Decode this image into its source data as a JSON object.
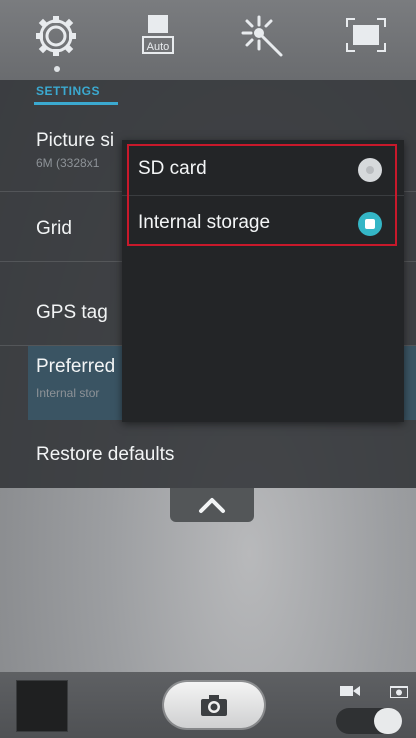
{
  "toolbar": {
    "settings_icon": "gear-icon",
    "scene_mode_label": "Auto",
    "effects_icon": "magic-wand-icon",
    "aspect_icon": "aspect-ratio-icon"
  },
  "settings": {
    "header": "SETTINGS",
    "rows": [
      {
        "title": "Picture si",
        "subtitle": "6M (3328x1"
      },
      {
        "title": "Grid"
      },
      {
        "title": "GPS tag"
      },
      {
        "title": "Preferred",
        "subtitle": "Internal stor"
      },
      {
        "title": "Restore defaults"
      }
    ]
  },
  "storage_popup": {
    "options": [
      {
        "label": "SD card",
        "selected": false
      },
      {
        "label": "Internal storage",
        "selected": true
      }
    ],
    "highlight_color": "#c8192b",
    "accent_color": "#34b6c6"
  },
  "bottom": {
    "shutter_icon": "camera-icon",
    "video_mode_icon": "video-camera-icon",
    "photo_mode_icon": "camera-icon",
    "mode": "photo"
  }
}
